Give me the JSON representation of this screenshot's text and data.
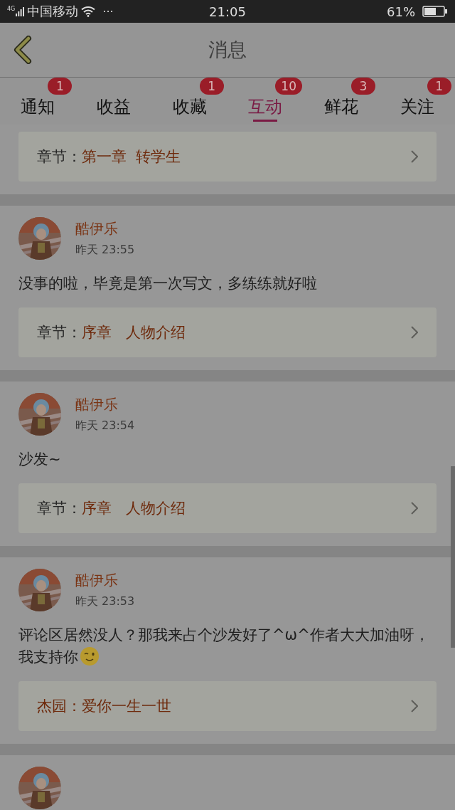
{
  "status_bar": {
    "network": "4G",
    "carrier": "中国移动",
    "more": "···",
    "time": "21:05",
    "battery": "61%"
  },
  "header": {
    "title": "消息"
  },
  "tabs": [
    {
      "label": "通知",
      "badge": "1",
      "selected": false
    },
    {
      "label": "收益",
      "selected": false
    },
    {
      "label": "收藏",
      "badge": "1",
      "selected": false
    },
    {
      "label": "互动",
      "badge": "10",
      "selected": true
    },
    {
      "label": "鲜花",
      "badge": "3",
      "selected": false
    },
    {
      "label": "关注",
      "badge": "1",
      "selected": false
    }
  ],
  "comments": [
    {
      "link": {
        "kind": "chapter",
        "label": "章节：",
        "title": "第一章  转学生"
      }
    },
    {
      "avatar": {
        "kind": "picture"
      },
      "name": "酷伊乐",
      "time": "昨天 23:55",
      "text": "没事的啦，毕竟是第一次写文，多练练就好啦",
      "trailing_emoji": false,
      "link": {
        "kind": "chapter",
        "label": "章节：",
        "title": "序章   人物介绍"
      }
    },
    {
      "avatar": {
        "kind": "picture"
      },
      "name": "酷伊乐",
      "time": "昨天 23:54",
      "text": "沙发~",
      "trailing_emoji": false,
      "link": {
        "kind": "chapter",
        "label": "章节：",
        "title": "序章   人物介绍"
      }
    },
    {
      "avatar": {
        "kind": "picture"
      },
      "name": "酷伊乐",
      "time": "昨天 23:53",
      "text": "评论区居然没人？那我来占个沙发好了^ω^作者大大加油呀，我支持你",
      "trailing_emoji": true,
      "link": {
        "kind": "reply",
        "label": "杰园：",
        "title": "爱你一生一世"
      }
    },
    {
      "avatar": {
        "kind": "picture"
      }
    }
  ]
}
